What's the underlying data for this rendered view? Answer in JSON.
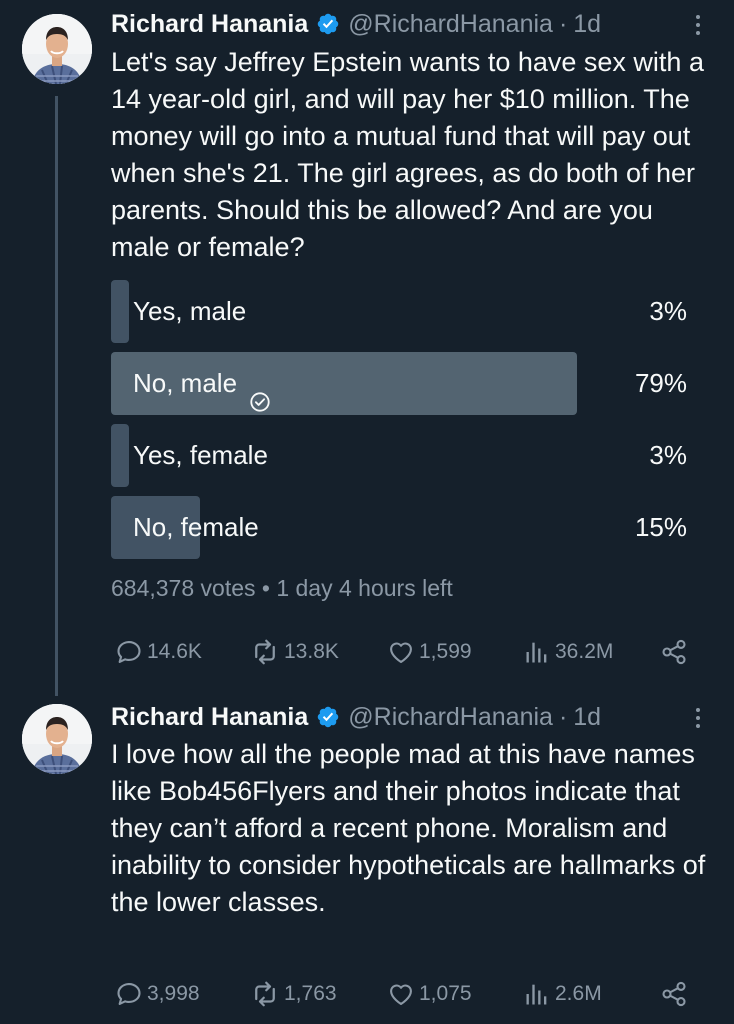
{
  "tweets": [
    {
      "author_name": "Richard Hanania",
      "handle": "@RichardHanania",
      "separator": "·",
      "time": "1d",
      "text": "Let's say Jeffrey Epstein wants to have sex with a 14 year-old girl, and will pay her $10 million. The money will go into a mutual fund that will pay out when she's 21. The girl agrees, as do both of her parents. Should this be allowed? And are you male or female?",
      "poll": {
        "options": [
          {
            "label": "Yes, male",
            "percent": "3%",
            "fraction": 0.03,
            "winner": false
          },
          {
            "label": "No, male",
            "percent": "79%",
            "fraction": 0.79,
            "winner": true
          },
          {
            "label": "Yes, female",
            "percent": "3%",
            "fraction": 0.03,
            "winner": false
          },
          {
            "label": "No, female",
            "percent": "15%",
            "fraction": 0.15,
            "winner": false
          }
        ],
        "meta": "684,378 votes • 1 day 4 hours left"
      },
      "actions": {
        "replies": "14.6K",
        "retweets": "13.8K",
        "likes": "1,599",
        "views": "36.2M"
      }
    },
    {
      "author_name": "Richard Hanania",
      "handle": "@RichardHanania",
      "separator": "·",
      "time": "1d",
      "text": "I love how all the people mad at this have names like Bob456Flyers and their photos indicate that they can’t afford a recent phone. Moralism and inability to consider hypotheticals are hallmarks of the lower classes.",
      "actions": {
        "replies": "3,998",
        "retweets": "1,763",
        "likes": "1,075",
        "views": "2.6M"
      }
    }
  ],
  "colors": {
    "background": "#15202b",
    "text": "#f7f9f9",
    "muted": "#8b98a5",
    "verified": "#1d9bf0",
    "poll_bar": "#425364",
    "poll_bar_winner": "#536471"
  },
  "icons": [
    "verified-badge-icon",
    "more-icon",
    "reply-icon",
    "retweet-icon",
    "like-icon",
    "views-icon",
    "share-icon",
    "check-circle-icon",
    "avatar"
  ]
}
